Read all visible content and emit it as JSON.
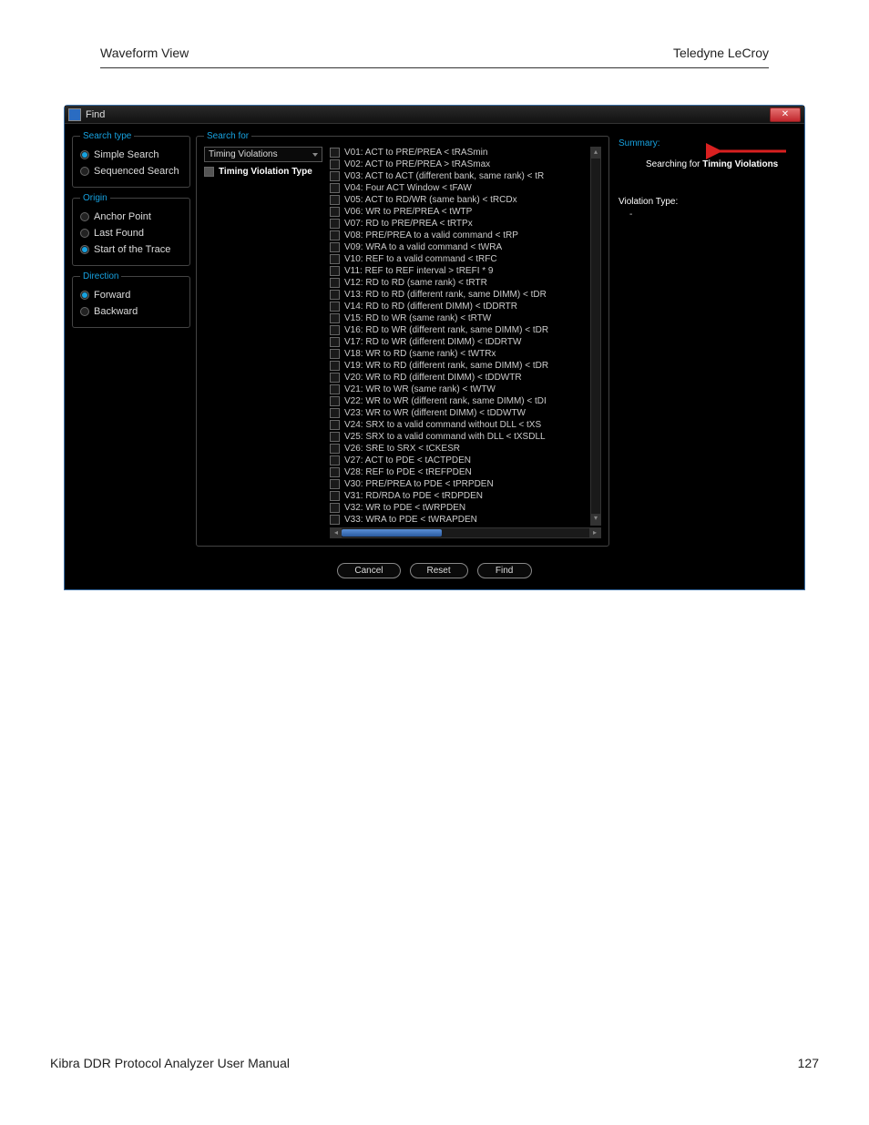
{
  "page": {
    "header_left": "Waveform View",
    "header_right": "Teledyne LeCroy",
    "footer_left": "Kibra DDR Protocol Analyzer User Manual",
    "footer_right": "127"
  },
  "dialog": {
    "title": "Find",
    "close": "✕",
    "search_type": {
      "legend": "Search type",
      "opts": [
        {
          "label": "Simple Search",
          "selected": true
        },
        {
          "label": "Sequenced Search",
          "selected": false
        }
      ]
    },
    "origin": {
      "legend": "Origin",
      "opts": [
        {
          "label": "Anchor Point",
          "selected": false
        },
        {
          "label": "Last Found",
          "selected": false
        },
        {
          "label": "Start of the Trace",
          "selected": true
        }
      ]
    },
    "direction": {
      "legend": "Direction",
      "opts": [
        {
          "label": "Forward",
          "selected": true
        },
        {
          "label": "Backward",
          "selected": false
        }
      ]
    },
    "search_for": {
      "legend": "Search for",
      "dropdown": "Timing Violations",
      "tvt_checkbox": "Timing Violation Type"
    },
    "violations": [
      "V01: ACT to PRE/PREA < tRASmin",
      "V02: ACT to PRE/PREA > tRASmax",
      "V03: ACT to ACT (different bank, same rank) < tR",
      "V04: Four ACT Window < tFAW",
      "V05: ACT to RD/WR (same bank) < tRCDx",
      "V06: WR to PRE/PREA < tWTP",
      "V07: RD to PRE/PREA < tRTPx",
      "V08: PRE/PREA to a valid command < tRP",
      "V09: WRA to a valid command < tWRA",
      "V10: REF to a valid command < tRFC",
      "V11: REF to REF interval > tREFI * 9",
      "V12: RD to RD (same rank) < tRTR",
      "V13: RD to RD (different rank, same DIMM) < tDR",
      "V14: RD to RD (different DIMM) < tDDRTR",
      "V15: RD to WR (same rank) < tRTW",
      "V16: RD to WR (different rank, same DIMM) < tDR",
      "V17: RD to WR (different DIMM) < tDDRTW",
      "V18: WR to RD (same rank) < tWTRx",
      "V19: WR to RD (different rank, same DIMM) < tDR",
      "V20: WR to RD (different DIMM) < tDDWTR",
      "V21: WR to WR (same rank) < tWTW",
      "V22: WR to WR (different rank, same DIMM) < tDI",
      "V23: WR to WR (different DIMM) < tDDWTW",
      "V24: SRX to a valid command without DLL < tXS",
      "V25: SRX to a valid command with DLL < tXSDLL",
      "V26: SRE to SRX < tCKESR",
      "V27: ACT to PDE < tACTPDEN",
      "V28: REF to PDE < tREFPDEN",
      "V30: PRE/PREA to PDE < tPRPDEN",
      "V31: RD/RDA to PDE < tRDPDEN",
      "V32: WR to PDE < tWRPDEN",
      "V33: WRA to PDE < tWRAPDEN"
    ],
    "summary": {
      "label": "Summary:",
      "text_prefix": "Searching for ",
      "text_bold": "Timing Violations",
      "vt_label": "Violation Type:",
      "vt_value": "-"
    },
    "buttons": {
      "cancel": "Cancel",
      "reset": "Reset",
      "find": "Find"
    }
  }
}
